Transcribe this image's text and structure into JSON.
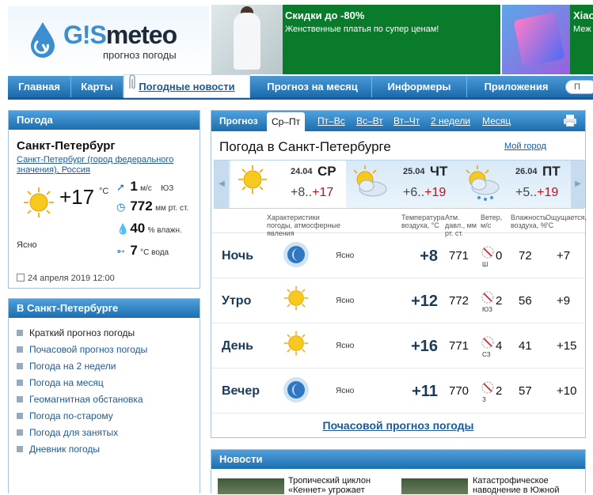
{
  "header": {
    "logo_gis": "G!S",
    "logo_meteo": "meteo",
    "logo_sub": "прогноз погоды",
    "ad1": {
      "title": "Скидки до -80%",
      "text": "Женственные платья по супер ценам!"
    },
    "ad2": {
      "title": "Xiao",
      "text": "Меж"
    }
  },
  "nav": {
    "items": [
      {
        "label": "Главная"
      },
      {
        "label": "Карты"
      },
      {
        "label": "Погодные новости"
      },
      {
        "label": "Прогноз на месяц"
      },
      {
        "label": "Информеры"
      },
      {
        "label": "Приложения"
      }
    ],
    "search_label": "П"
  },
  "current": {
    "header": "Погода",
    "city": "Санкт-Петербург",
    "region": "Санкт-Петербург (город федерального значения), Россия",
    "temp": "+17",
    "temp_unit": "°C",
    "condition": "Ясно",
    "wind_value": "1",
    "wind_unit": "м/с",
    "wind_dir": "ЮЗ",
    "pressure_value": "772",
    "pressure_unit": "мм рт. ст.",
    "humidity_value": "40",
    "humidity_unit": "% влажн.",
    "water_value": "7",
    "water_unit": "°C вода",
    "date": "24 апреля 2019 12:00"
  },
  "city_links": {
    "header": "В Санкт-Петербурге",
    "items": [
      "Краткий прогноз погоды",
      "Почасовой прогноз погоды",
      "Погода на 2 недели",
      "Погода на месяц",
      "Геомагнитная обстановка",
      "Погода по-старому",
      "Погода для занятых",
      "Дневник погоды"
    ]
  },
  "forecast": {
    "tabs": [
      "Прогноз",
      "Ср–Пт",
      "Пт–Вс",
      "Вс–Вт",
      "Вт–Чт",
      "2 недели",
      "Месяц"
    ],
    "active_tab": "Ср–Пт",
    "title": "Погода в Санкт-Петербурге",
    "my_city": "Мой город",
    "days": [
      {
        "date": "24.04",
        "dow": "СР",
        "lo": "+8..",
        "hi": "+17",
        "icon": "sun-icon"
      },
      {
        "date": "25.04",
        "dow": "ЧТ",
        "lo": "+6..",
        "hi": "+19",
        "icon": "cloud-sun-icon"
      },
      {
        "date": "26.04",
        "dow": "ПТ",
        "lo": "+5..",
        "hi": "+19",
        "icon": "cloud-sun-rain-icon"
      }
    ],
    "col_heads": {
      "cond": "Характеристики погоды, атмосферные явления",
      "temp": "Температура воздуха, °C",
      "press": "Атм. давл., мм рт. ст.",
      "wind": "Ветер, м/с",
      "hum": "Влажность воздуха, %",
      "feels": "Ощущается, °C"
    },
    "periods": [
      {
        "name": "Ночь",
        "icon": "moon-icon",
        "cond": "Ясно",
        "temp": "+8",
        "press": "771",
        "wind": "0",
        "wind_dir": "Ш",
        "hum": "72",
        "feels": "+7"
      },
      {
        "name": "Утро",
        "icon": "sun-icon",
        "cond": "Ясно",
        "temp": "+12",
        "press": "772",
        "wind": "2",
        "wind_dir": "ЮЗ",
        "hum": "56",
        "feels": "+9"
      },
      {
        "name": "День",
        "icon": "sun-icon",
        "cond": "Ясно",
        "temp": "+16",
        "press": "771",
        "wind": "4",
        "wind_dir": "СЗ",
        "hum": "41",
        "feels": "+15"
      },
      {
        "name": "Вечер",
        "icon": "moon-icon",
        "cond": "Ясно",
        "temp": "+11",
        "press": "770",
        "wind": "2",
        "wind_dir": "З",
        "hum": "57",
        "feels": "+10"
      }
    ],
    "hourly_link": "Почасовой прогноз погоды"
  },
  "news": {
    "header": "Новости",
    "items": [
      {
        "text": "Тропический циклон «Кеннет» угрожает"
      },
      {
        "text": "Катастрофическое наводнение в Южной"
      }
    ]
  },
  "colors": {
    "accent": "#1d6ead",
    "temp_high": "#c0101c",
    "ad_green": "#0a7a2b"
  }
}
